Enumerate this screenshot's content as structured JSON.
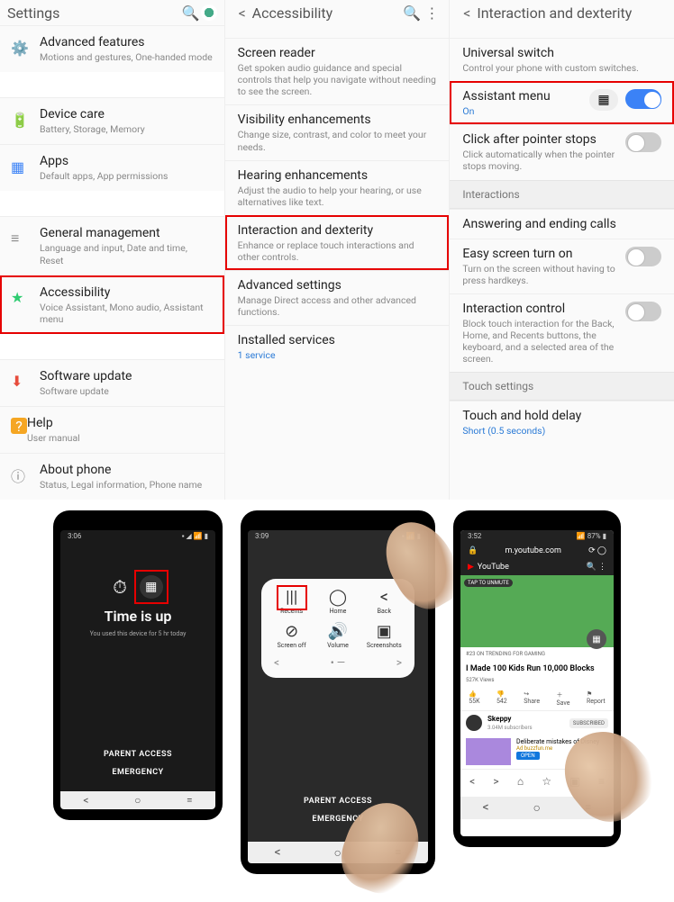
{
  "settings": {
    "title": "Settings",
    "items": [
      {
        "icon": "⚙️",
        "color": "#f5a623",
        "label": "Advanced features",
        "sub": "Motions and gestures, One-handed mode"
      },
      {
        "icon": "🔋",
        "color": "#2ecc71",
        "label": "Device care",
        "sub": "Battery, Storage, Memory"
      },
      {
        "icon": "▦",
        "color": "#3b82f6",
        "label": "Apps",
        "sub": "Default apps, App permissions"
      },
      {
        "icon": "≡",
        "color": "#888",
        "label": "General management",
        "sub": "Language and input, Date and time, Reset"
      },
      {
        "icon": "★",
        "color": "#2ecc71",
        "label": "Accessibility",
        "sub": "Voice Assistant, Mono audio, Assistant menu"
      },
      {
        "icon": "⬇",
        "color": "#e74c3c",
        "label": "Software update",
        "sub": "Software update"
      },
      {
        "icon": "?",
        "color": "#f5a623",
        "label": "Help",
        "sub": "User manual"
      },
      {
        "icon": "ⓘ",
        "color": "#888",
        "label": "About phone",
        "sub": "Status, Legal information, Phone name"
      }
    ]
  },
  "accessibility": {
    "title": "Accessibility",
    "items": [
      {
        "label": "Screen reader",
        "sub": "Get spoken audio guidance and special controls that help you navigate without needing to see the screen."
      },
      {
        "label": "Visibility enhancements",
        "sub": "Change size, contrast, and color to meet your needs."
      },
      {
        "label": "Hearing enhancements",
        "sub": "Adjust the audio to help your hearing, or use alternatives like text."
      },
      {
        "label": "Interaction and dexterity",
        "sub": "Enhance or replace touch interactions and other controls."
      },
      {
        "label": "Advanced settings",
        "sub": "Manage Direct access and other advanced functions."
      },
      {
        "label": "Installed services",
        "sub": "1 service",
        "link": true
      }
    ]
  },
  "interaction": {
    "title": "Interaction and dexterity",
    "items": [
      {
        "label": "Universal switch",
        "sub": "Control your phone with custom switches."
      },
      {
        "label": "Assistant menu",
        "sub": "On",
        "link": true,
        "chip": true,
        "toggle": "on",
        "hl": true
      },
      {
        "label": "Click after pointer stops",
        "sub": "Click automatically when the pointer stops moving.",
        "toggle": "off"
      }
    ],
    "sec1": "Interactions",
    "items2": [
      {
        "label": "Answering and ending calls"
      },
      {
        "label": "Easy screen turn on",
        "sub": "Turn on the screen without having to press hardkeys.",
        "toggle": "off"
      },
      {
        "label": "Interaction control",
        "sub": "Block touch interaction for the Back, Home, and Recents buttons, the keyboard, and a selected area of the screen.",
        "toggle": "off"
      }
    ],
    "sec2": "Touch settings",
    "items3": [
      {
        "label": "Touch and hold delay",
        "sub": "Short (0.5 seconds)",
        "link": true
      }
    ]
  },
  "phone1": {
    "time": "3:06",
    "title": "Time is up",
    "sub": "You used this device for 5 hr today",
    "parent": "PARENT ACCESS",
    "emerg": "EMERGENCY"
  },
  "phone2": {
    "time": "3:09",
    "menu": [
      {
        "ic": "|||",
        "lb": "Recents",
        "hl": true
      },
      {
        "ic": "◯",
        "lb": "Home"
      },
      {
        "ic": "<",
        "lb": "Back"
      },
      {
        "ic": "⊘",
        "lb": "Screen off"
      },
      {
        "ic": "🔊",
        "lb": "Volume"
      },
      {
        "ic": "▣",
        "lb": "Screenshots"
      }
    ],
    "parent": "PARENT ACCESS",
    "emerg": "EMERGENCY"
  },
  "phone3": {
    "time": "3:52",
    "url": "m.youtube.com",
    "brand": "YouTube",
    "tag": "TAP TO UNMUTE",
    "trend": "#23 ON TRENDING FOR GAMING",
    "vtitle": "I Made 100 Kids Run 10,000 Blocks",
    "views": "527K Views",
    "actions": [
      "55K",
      "542",
      "Share",
      "Save",
      "Report"
    ],
    "channel": "Skeppy",
    "chsub": "3.04M subscribers",
    "badge": "SUBSCRIBED",
    "rectitle": "Deliberate mistakes of Disney",
    "recsub": "Ad buzzfun.me",
    "open": "OPEN"
  }
}
